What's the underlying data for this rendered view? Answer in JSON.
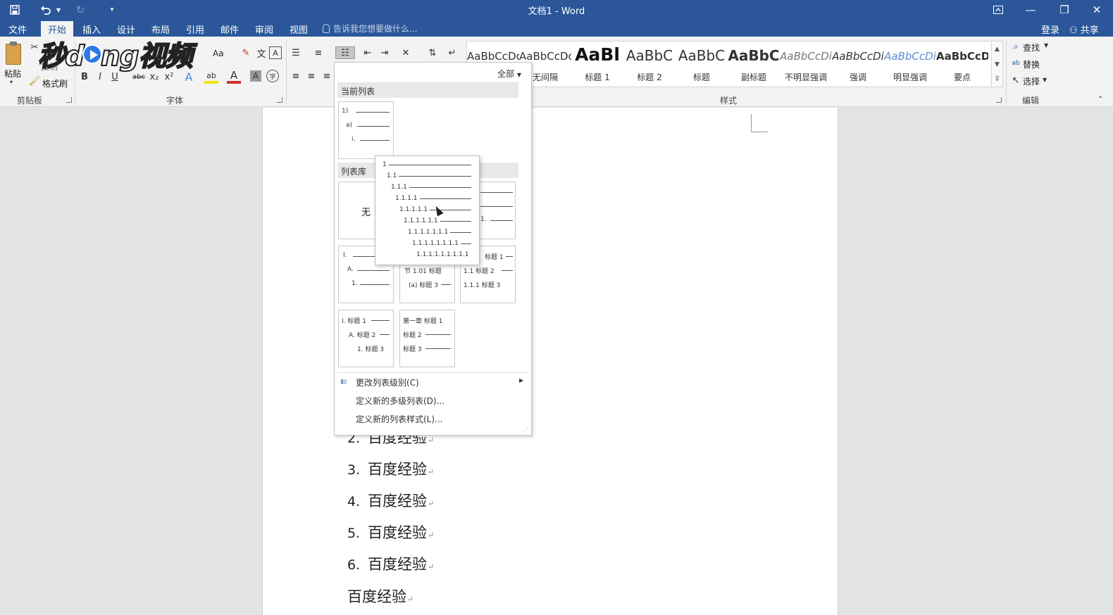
{
  "window": {
    "title": "文档1 - Word",
    "qa_save_icon": "save-icon",
    "qa_undo_icon": "undo-icon",
    "qa_redo_icon": "redo-icon",
    "qa_customize_icon": "customize-quick-access-icon",
    "ribbon_display_icon": "ribbon-display-options-icon",
    "minimize": "—",
    "restore": "❐",
    "close": "✕"
  },
  "tabs": [
    {
      "label": "文件",
      "active": false
    },
    {
      "label": "开始",
      "active": true
    },
    {
      "label": "插入",
      "active": false
    },
    {
      "label": "设计",
      "active": false
    },
    {
      "label": "布局",
      "active": false
    },
    {
      "label": "引用",
      "active": false
    },
    {
      "label": "邮件",
      "active": false
    },
    {
      "label": "审阅",
      "active": false
    },
    {
      "label": "视图",
      "active": false
    }
  ],
  "tell_me": {
    "placeholder": "告诉我您想要做什么..."
  },
  "account": {
    "login": "登录",
    "share": "共享"
  },
  "ribbon": {
    "clipboard": {
      "paste": "粘贴",
      "copy": "复制",
      "format_painter": "格式刷",
      "label": "剪贴板"
    },
    "font": {
      "label": "字体",
      "change_case": "Aa",
      "bold": "B",
      "italic": "I",
      "underline": "U",
      "strikethrough": "abc",
      "subscript": "x₂",
      "superscript": "x²",
      "text_effects": "A",
      "highlight": "ab",
      "font_color": "A",
      "char_shading": "A",
      "enclose": "字"
    },
    "styles": {
      "label": "样式",
      "items": [
        {
          "sample": "AaBbCcDc",
          "name": ""
        },
        {
          "sample": "AaBbCcDc",
          "name": "无间隔"
        },
        {
          "sample": "AaBl",
          "name": "标题 1"
        },
        {
          "sample": "AaBbC",
          "name": "标题 2"
        },
        {
          "sample": "AaBbC",
          "name": "标题"
        },
        {
          "sample": "AaBbC",
          "name": "副标题"
        },
        {
          "sample": "AaBbCcDi",
          "name": "不明显强调"
        },
        {
          "sample": "AaBbCcDi",
          "name": "强调"
        },
        {
          "sample": "AaBbCcDi",
          "name": "明显强调"
        },
        {
          "sample": "AaBbCcD",
          "name": "要点"
        }
      ]
    },
    "editing": {
      "label": "编辑",
      "find": "查找",
      "replace": "替换",
      "select": "选择"
    }
  },
  "watermark": {
    "text_a": "秒d",
    "text_b": "ng视频"
  },
  "dropdown": {
    "filter": "全部",
    "current_list_title": "当前列表",
    "library_title": "列表库",
    "none_label": "无",
    "current_thumb": [
      "1)",
      "a)",
      "i."
    ],
    "thumb_hidden_right": [
      "1."
    ],
    "thumb_row2": [
      [
        "I.",
        "A.",
        "1."
      ],
      [
        "节 1.01 标题",
        "(a) 标题 3"
      ],
      [
        "标题 1",
        "1.1 标题 2",
        "1.1.1 标题 3"
      ]
    ],
    "thumb_row3": [
      [
        "I. 标题 1",
        "A. 标题 2",
        "1. 标题 3"
      ],
      [
        "第一章 标题 1",
        "标题 2",
        "标题 3"
      ]
    ],
    "preview_rows": [
      "1",
      "1.1",
      "1.1.1",
      "1.1.1.1",
      "1.1.1.1.1",
      "1.1.1.1.1.1",
      "1.1.1.1.1.1.1",
      "1.1.1.1.1.1.1.1",
      "1.1.1.1.1.1.1.1.1"
    ],
    "menu": {
      "change_level": "更改列表级别(C)",
      "define_multilevel": "定义新的多级列表(D)...",
      "define_style": "定义新的列表样式(L)..."
    }
  },
  "document": {
    "lines": [
      {
        "num": "2.",
        "text": "百度经验"
      },
      {
        "num": "3.",
        "text": "百度经验"
      },
      {
        "num": "4.",
        "text": "百度经验"
      },
      {
        "num": "5.",
        "text": "百度经验"
      },
      {
        "num": "6.",
        "text": "百度经验"
      },
      {
        "num": "",
        "text": "百度经验"
      }
    ],
    "para_mark": "↵"
  }
}
